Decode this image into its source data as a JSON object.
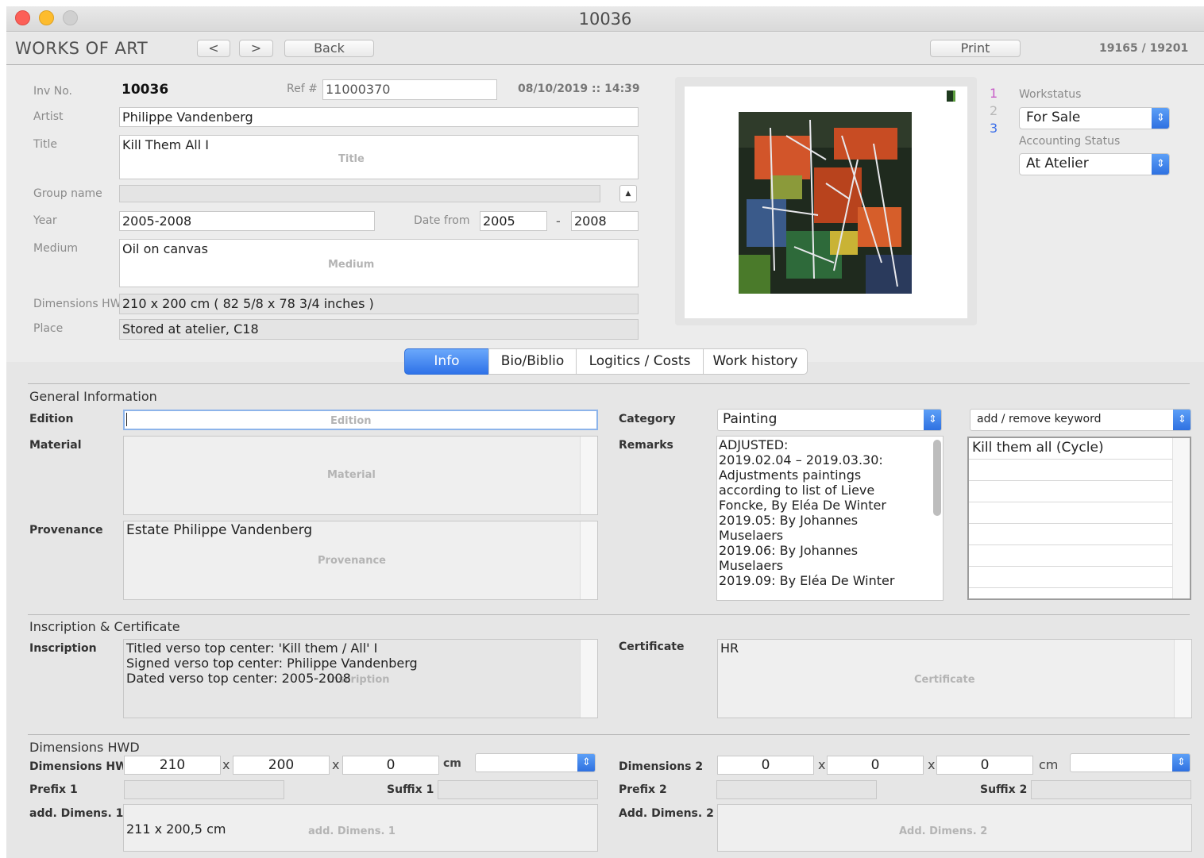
{
  "window": {
    "title": "10036"
  },
  "toolbar": {
    "section_title": "WORKS OF ART",
    "prev_label": "<",
    "next_label": ">",
    "back_label": "Back",
    "print_label": "Print",
    "record_counter": "19165 / 19201"
  },
  "header": {
    "inv_label": "Inv No.",
    "inv_value": "10036",
    "ref_label": "Ref #",
    "ref_value": "11000370",
    "timestamp": "08/10/2019 :: 14:39",
    "artist_label": "Artist",
    "artist_value": "Philippe Vandenberg",
    "title_label": "Title",
    "title_value": "Kill Them All I",
    "title_placeholder": "Title",
    "group_label": "Group name",
    "group_value": "",
    "year_label": "Year",
    "year_value": "2005-2008",
    "date_from_label": "Date from",
    "date_from_value": "2005",
    "date_dash": "-",
    "date_to_value": "2008",
    "medium_label": "Medium",
    "medium_value": "Oil on canvas",
    "medium_placeholder": "Medium",
    "dimensions_label": "Dimensions HW",
    "dimensions_value": "210 x 200 cm ( 82 5/8 x 78 3/4 inches )",
    "place_label": "Place",
    "place_value": "Stored at atelier, C18"
  },
  "image_pager": [
    "1",
    "2",
    "3"
  ],
  "status": {
    "workstatus_label": "Workstatus",
    "workstatus_value": "For Sale",
    "accounting_label": "Accounting Status",
    "accounting_value": "At Atelier"
  },
  "tabs": [
    "Info",
    "Bio/Biblio",
    "Logitics / Costs",
    "Work history"
  ],
  "general": {
    "section_title": "General Information",
    "edition_label": "Edition",
    "edition_value": "",
    "edition_placeholder": "Edition",
    "material_label": "Material",
    "material_value": "",
    "material_placeholder": "Material",
    "provenance_label": "Provenance",
    "provenance_value": "Estate Philippe Vandenberg",
    "provenance_placeholder": "Provenance",
    "category_label": "Category",
    "category_value": "Painting",
    "remarks_label": "Remarks",
    "remarks_lines": [
      "ADJUSTED:",
      "2019.02.04 – 2019.03.30:",
      "Adjustments paintings",
      "according to list of Lieve",
      "Foncke, By Eléa De Winter",
      "2019.05: By Johannes",
      "Muselaers",
      "2019.06: By Johannes",
      "Muselaers",
      "2019.09: By Eléa De Winter"
    ],
    "keyword_select": "add / remove keyword",
    "keywords": [
      "Kill them all (Cycle)",
      "",
      "",
      "",
      "",
      "",
      "",
      ""
    ]
  },
  "inscription": {
    "section_title": "Inscription & Certificate",
    "inscription_label": "Inscription",
    "inscription_lines": [
      "Titled verso top center: 'Kill them / All' I",
      "Signed verso top center: Philippe Vandenberg",
      "Dated verso top center: 2005-2008"
    ],
    "inscription_placeholder": "Inscription",
    "certificate_label": "Certificate",
    "certificate_value": "HR",
    "certificate_placeholder": "Certificate"
  },
  "dimensions": {
    "section_title": "Dimensions HWD",
    "dims1_label": "Dimensions HWD",
    "h1": "210",
    "w1": "200",
    "d1": "0",
    "unit1": "cm",
    "unit_select1": "",
    "dims2_label": "Dimensions 2",
    "h2": "0",
    "w2": "0",
    "d2": "0",
    "unit2": "cm",
    "unit_select2": "",
    "x": "x",
    "prefix1_label": "Prefix 1",
    "prefix1_value": "",
    "suffix1_label": "Suffix 1",
    "suffix1_value": "",
    "prefix2_label": "Prefix 2",
    "prefix2_value": "",
    "suffix2_label": "Suffix 2",
    "suffix2_value": "",
    "add1_label": "add. Dimens. 1",
    "add1_value": "211 x 200,5 cm",
    "add1_placeholder": "add. Dimens. 1",
    "add2_label": "Add. Dimens. 2",
    "add2_value": "",
    "add2_placeholder": "Add. Dimens. 2"
  },
  "colors": {
    "accent": "#3478f6",
    "tab_active": "#3b84f5",
    "pager_1": "#c85ec8",
    "pager_2": "#b8b8b8",
    "pager_3": "#3b6ee8"
  }
}
